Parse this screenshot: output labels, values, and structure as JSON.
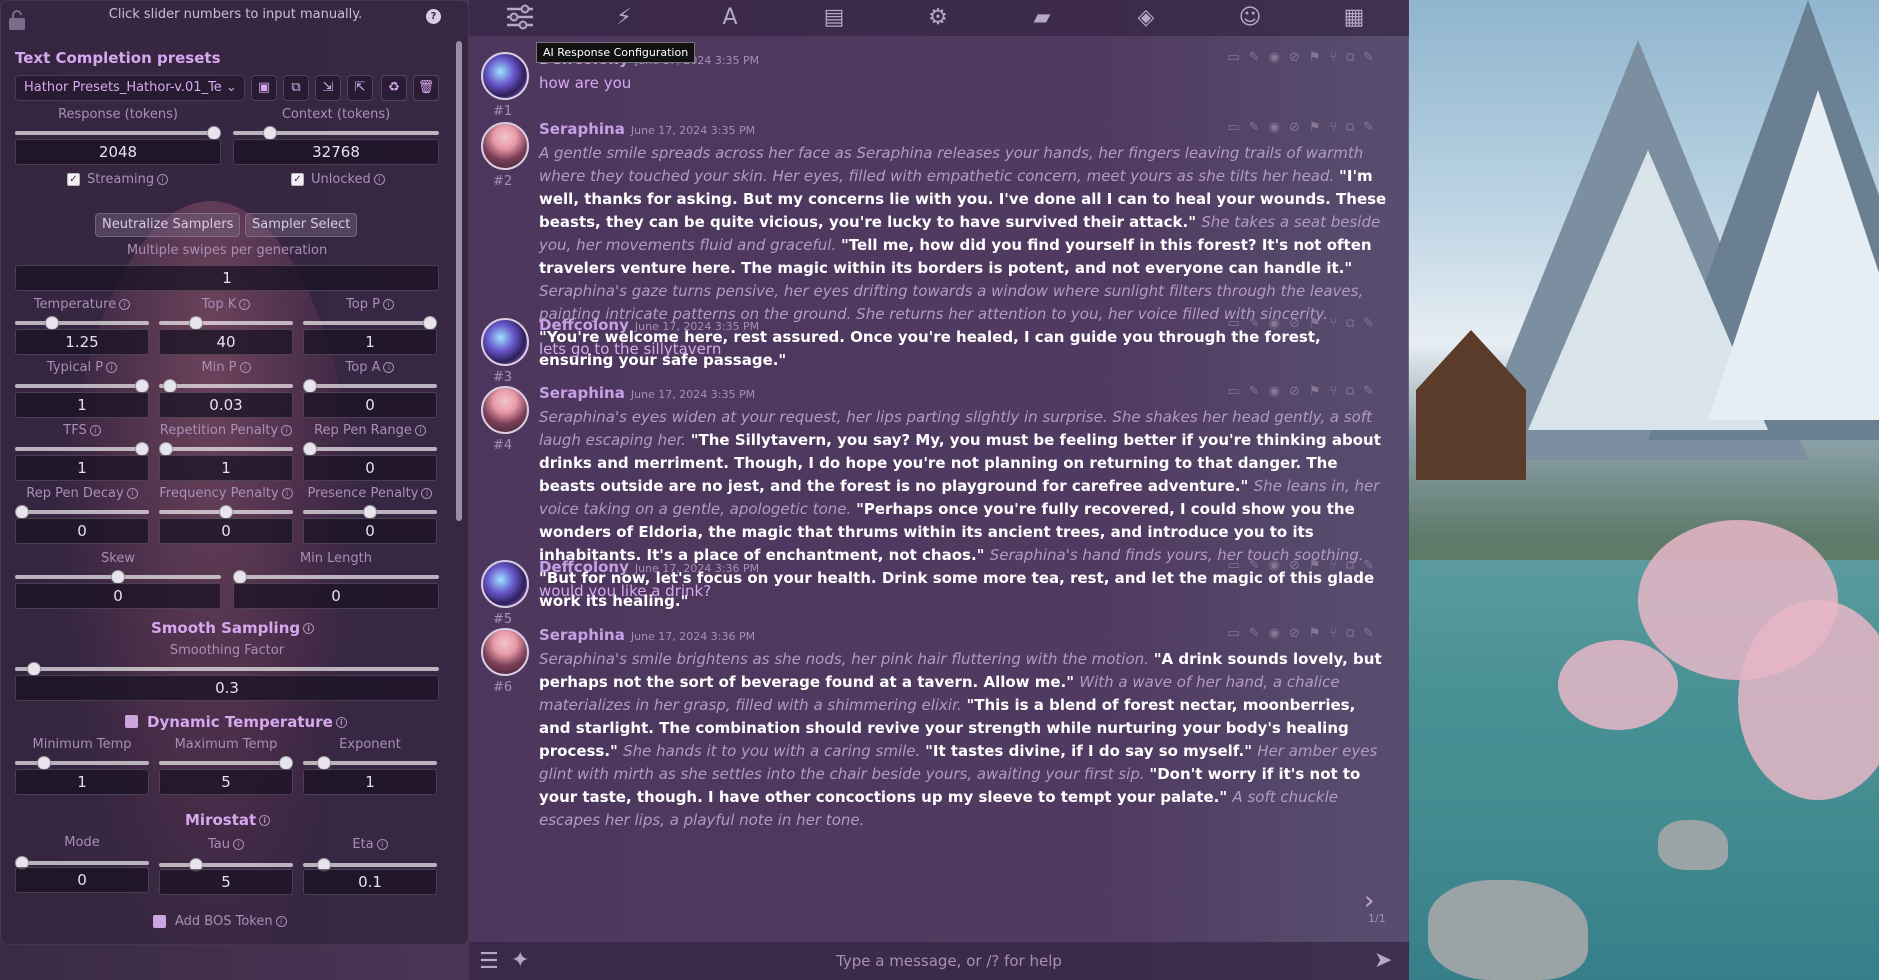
{
  "panel": {
    "tip": "Click slider numbers to input manually.",
    "section_title": "Text Completion presets",
    "preset_value": "Hathor Presets_Hathor-v.01_Te",
    "response_label": "Response (tokens)",
    "context_label": "Context (tokens)",
    "response_value": "2048",
    "context_value": "32768",
    "streaming_label": "Streaming",
    "unlocked_label": "Unlocked",
    "neutralize_label": "Neutralize Samplers",
    "sampler_select_label": "Sampler Select",
    "swipes_label": "Multiple swipes per generation",
    "swipes_value": "1",
    "params": [
      {
        "label": "Temperature",
        "value": "1.25",
        "fill": 0.25
      },
      {
        "label": "Top K",
        "value": "40",
        "fill": 0.25
      },
      {
        "label": "Top P",
        "value": "1",
        "fill": 1.0
      },
      {
        "label": "Typical P",
        "value": "1",
        "fill": 1.0
      },
      {
        "label": "Min P",
        "value": "0.03",
        "fill": 0.03
      },
      {
        "label": "Top A",
        "value": "0",
        "fill": 0.0
      },
      {
        "label": "TFS",
        "value": "1",
        "fill": 1.0
      },
      {
        "label": "Repetition Penalty",
        "value": "1",
        "fill": 0.0
      },
      {
        "label": "Rep Pen Range",
        "value": "0",
        "fill": 0.0
      },
      {
        "label": "Rep Pen Decay",
        "value": "0",
        "fill": 0.0
      },
      {
        "label": "Frequency Penalty",
        "value": "0",
        "fill": 0.5
      },
      {
        "label": "Presence Penalty",
        "value": "0",
        "fill": 0.5
      }
    ],
    "skew_label": "Skew",
    "skew_value": "0",
    "min_length_label": "Min Length",
    "min_length_value": "0",
    "smooth_title": "Smooth Sampling",
    "smooth_factor_label": "Smoothing Factor",
    "smooth_factor_value": "0.3",
    "dyntemp_title": "Dynamic Temperature",
    "min_temp_label": "Minimum Temp",
    "min_temp_value": "1",
    "max_temp_label": "Maximum Temp",
    "max_temp_value": "5",
    "exponent_label": "Exponent",
    "exponent_value": "1",
    "mirostat_title": "Mirostat",
    "mode_label": "Mode",
    "mode_value": "0",
    "tau_label": "Tau",
    "tau_value": "5",
    "eta_label": "Eta",
    "eta_value": "0.1",
    "bos_label": "Add BOS Token"
  },
  "nav": {
    "tooltip": "AI Response Configuration",
    "icons": [
      "sliders-icon",
      "plug-icon",
      "font-icon",
      "book-icon",
      "user-gear-icon",
      "image-icon",
      "cubes-icon",
      "smiley-icon",
      "id-card-icon"
    ]
  },
  "messages": [
    {
      "id": "#1",
      "name": "Deffcolony",
      "time": "June 17, 2024 3:35 PM",
      "type": "user",
      "segments": [
        {
          "k": "plain",
          "t": "how are you"
        }
      ]
    },
    {
      "id": "#2",
      "name": "Seraphina",
      "time": "June 17, 2024 3:35 PM",
      "type": "char",
      "segments": [
        {
          "k": "it",
          "t": "A gentle smile spreads across her face as Seraphina releases your hands, her fingers leaving trails of warmth where they touched your skin. Her eyes, filled with empathetic concern, meet yours as she tilts her head. "
        },
        {
          "k": "q",
          "t": "\"I'm well, thanks for asking. But my concerns lie with you. I've done all I can to heal your wounds. These beasts, they can be quite vicious, you're lucky to have survived their attack.\" "
        },
        {
          "k": "it",
          "t": "She takes a seat beside you, her movements fluid and graceful. "
        },
        {
          "k": "q",
          "t": "\"Tell me, how did you find yourself in this forest? It's not often travelers venture here. The magic within its borders is potent, and not everyone can handle it.\" "
        },
        {
          "k": "it",
          "t": "Seraphina's gaze turns pensive, her eyes drifting towards a window where sunlight filters through the leaves, painting intricate patterns on the ground. She returns her attention to you, her voice filled with sincerity. "
        },
        {
          "k": "q",
          "t": "\"You're welcome here, rest assured. Once you're healed, I can guide you through the forest, ensuring your safe passage.\""
        }
      ]
    },
    {
      "id": "#3",
      "name": "Deffcolony",
      "time": "June 17, 2024 3:35 PM",
      "type": "user",
      "segments": [
        {
          "k": "plain",
          "t": "lets go to the sillytavern"
        }
      ]
    },
    {
      "id": "#4",
      "name": "Seraphina",
      "time": "June 17, 2024 3:35 PM",
      "type": "char",
      "segments": [
        {
          "k": "it",
          "t": "Seraphina's eyes widen at your request, her lips parting slightly in surprise. She shakes her head gently, a soft laugh escaping her. "
        },
        {
          "k": "q",
          "t": "\"The Sillytavern, you say? My, you must be feeling better if you're thinking about drinks and merriment. Though, I do hope you're not planning on returning to that danger. The beasts outside are no jest, and the forest is no playground for carefree adventure.\" "
        },
        {
          "k": "it",
          "t": "She leans in, her voice taking on a gentle, apologetic tone. "
        },
        {
          "k": "q",
          "t": "\"Perhaps once you're fully recovered, I could show you the wonders of Eldoria, the magic that thrums within its ancient trees, and introduce you to its inhabitants. It's a place of enchantment, not chaos.\" "
        },
        {
          "k": "it",
          "t": "Seraphina's hand finds yours, her touch soothing. "
        },
        {
          "k": "q",
          "t": "\"But for now, let's focus on your health. Drink some more tea, rest, and let the magic of this glade work its healing.\""
        }
      ]
    },
    {
      "id": "#5",
      "name": "Deffcolony",
      "time": "June 17, 2024 3:36 PM",
      "type": "user",
      "segments": [
        {
          "k": "plain",
          "t": "would you like a drink?"
        }
      ]
    },
    {
      "id": "#6",
      "name": "Seraphina",
      "time": "June 17, 2024 3:36 PM",
      "type": "char",
      "segments": [
        {
          "k": "it",
          "t": "Seraphina's smile brightens as she nods, her pink hair fluttering with the motion. "
        },
        {
          "k": "q",
          "t": "\"A drink sounds lovely, but perhaps not the sort of beverage found at a tavern. Allow me.\" "
        },
        {
          "k": "it",
          "t": "With a wave of her hand, a chalice materializes in her grasp, filled with a shimmering elixir. "
        },
        {
          "k": "q",
          "t": "\"This is a blend of forest nectar, moonberries, and starlight. The combination should revive your strength while nurturing your body's healing process.\" "
        },
        {
          "k": "it",
          "t": "She hands it to you with a caring smile. "
        },
        {
          "k": "q",
          "t": "\"It tastes divine, if I do say so myself.\" "
        },
        {
          "k": "it",
          "t": "Her amber eyes glint with mirth as she settles into the chair beside yours, awaiting your first sip. "
        },
        {
          "k": "q",
          "t": "\"Don't worry if it's not to your taste, though. I have other concoctions up my sleeve to tempt your palate.\" "
        },
        {
          "k": "it",
          "t": "A soft chuckle escapes her lips, a playful note in her tone."
        }
      ]
    }
  ],
  "swipe_count": "1/1",
  "input": {
    "placeholder": "Type a message, or /? for help"
  }
}
